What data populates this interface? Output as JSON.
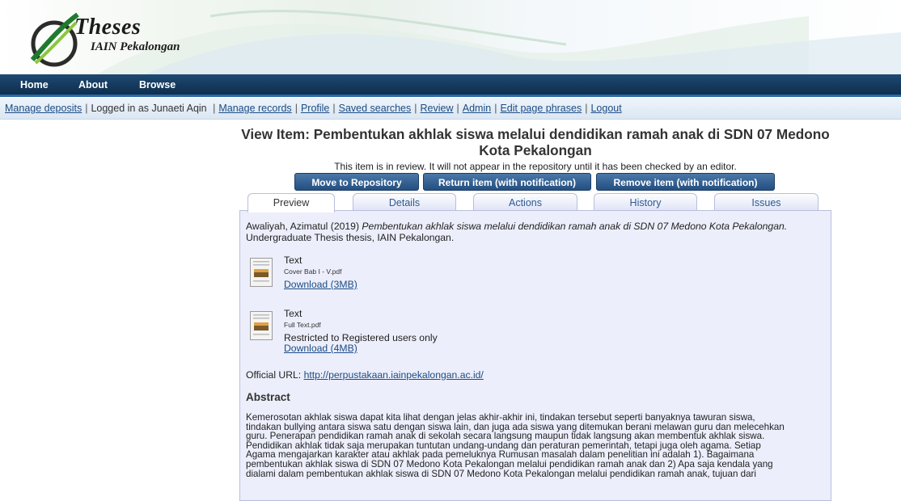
{
  "banner": {
    "logo_title": "Theses",
    "logo_subtitle": "IAIN  Pekalongan"
  },
  "nav": {
    "items": [
      "Home",
      "About",
      "Browse"
    ]
  },
  "userbar": {
    "manage_deposits": "Manage deposits",
    "logged_in": "Logged in as Junaeti Aqin",
    "manage_records": "Manage records",
    "profile": "Profile",
    "saved_searches": "Saved searches",
    "review": "Review",
    "admin": "Admin",
    "edit_page_phrases": "Edit page phrases",
    "logout": "Logout"
  },
  "page": {
    "title": "View Item: Pembentukan akhlak siswa melalui dendidikan ramah anak di SDN 07 Medono Kota Pekalongan",
    "notice": "This item is in review. It will not appear in the repository until it has been checked by an editor."
  },
  "action_buttons": {
    "move": "Move to Repository",
    "return": "Return item (with notification)",
    "remove": "Remove item (with notification)"
  },
  "tabs": [
    "Preview",
    "Details",
    "Actions",
    "History",
    "Issues"
  ],
  "item": {
    "citation_author": "Awaliyah, Azimatul (2019)",
    "citation_title": "Pembentukan akhlak siswa melalui dendidikan ramah anak di SDN 07 Medono Kota Pekalongan.",
    "citation_rest": "Undergraduate Thesis thesis, IAIN Pekalongan.",
    "documents": [
      {
        "type": "Text",
        "filename": "Cover Bab I - V.pdf",
        "download": "Download (3MB)"
      },
      {
        "type": "Text",
        "filename": "Full Text.pdf",
        "restriction": "Restricted to Registered users only",
        "download": "Download (4MB)"
      }
    ],
    "official_url_label": "Official URL:",
    "official_url": "http://perpustakaan.iainpekalongan.ac.id/",
    "abstract_heading": "Abstract",
    "abstract_lines": [
      "Kemerosotan akhlak siswa dapat kita lihat dengan jelas akhir-akhir ini, tindakan tersebut seperti banyaknya tawuran siswa,",
      "tindakan bullying antara siswa satu dengan siswa lain, dan juga ada siswa yang ditemukan berani melawan guru dan melecehkan",
      "guru. Penerapan pendidikan ramah anak di sekolah secara langsung maupun tidak langsung akan membentuk akhlak siswa.",
      "Pendidikan akhlak tidak saja merupakan tuntutan undang-undang dan peraturan pemerintah, tetapi juga oleh agama. Setiap",
      "Agama mengajarkan karakter atau akhlak pada pemeluknya Rumusan masalah dalam penelitian ini adalah 1). Bagaimana",
      "pembentukan akhlak siswa di SDN 07 Medono Kota Pekalongan melalui pendidikan ramah anak dan 2) Apa saja kendala yang",
      "dialami dalam pembentukan akhlak siswa di SDN 07 Medono Kota Pekalongan melalui pendidikan ramah anak, tujuan dari"
    ]
  }
}
